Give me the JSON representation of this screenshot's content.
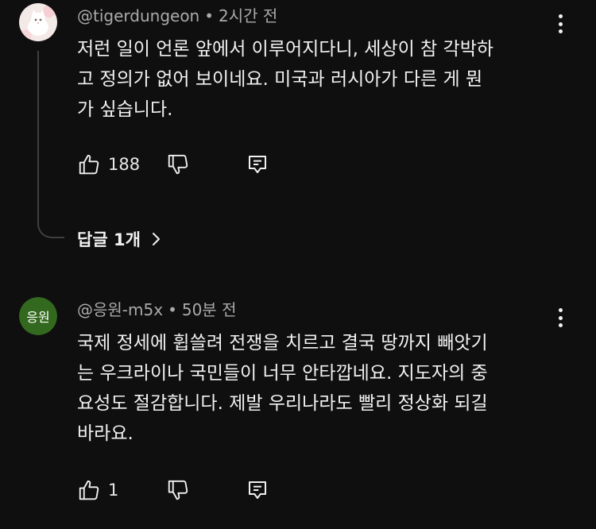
{
  "comments": [
    {
      "author": "@tigerdungeon",
      "separator": "•",
      "time": "2시간 전",
      "text": "저런 일이 언론 앞에서 이루어지다니, 세상이 참 각박하\n고 정의가 없어 보이네요. 미국과 러시아가 다른 게 뭔\n가 싶습니다.",
      "likes": "188",
      "avatar_icon": "white-cat-avatar",
      "replies_label": "답글 1개"
    },
    {
      "author": "@응원-m5x",
      "separator": "•",
      "time": "50분 전",
      "text": "국제 정세에 휩쓸려 전쟁을 치르고 결국 땅까지 빼앗기\n는 우크라이나 국민들이 너무 안타깝네요. 지도자의 중\n요성도 절감합니다. 제발 우리나라도 빨리 정상화 되길\n바라요.",
      "likes": "1",
      "avatar_text": "응원",
      "avatar_color": "#33691e"
    }
  ],
  "colors": {
    "background": "#0f0f0f",
    "text": "#f1f1f1",
    "meta": "#aaaaaa",
    "thread_line": "#3f3f3f"
  },
  "icons": {
    "like": "thumbs-up-icon",
    "dislike": "thumbs-down-icon",
    "reply": "comment-reply-icon",
    "more": "kebab-menu-icon",
    "chevron": "chevron-right-icon"
  }
}
